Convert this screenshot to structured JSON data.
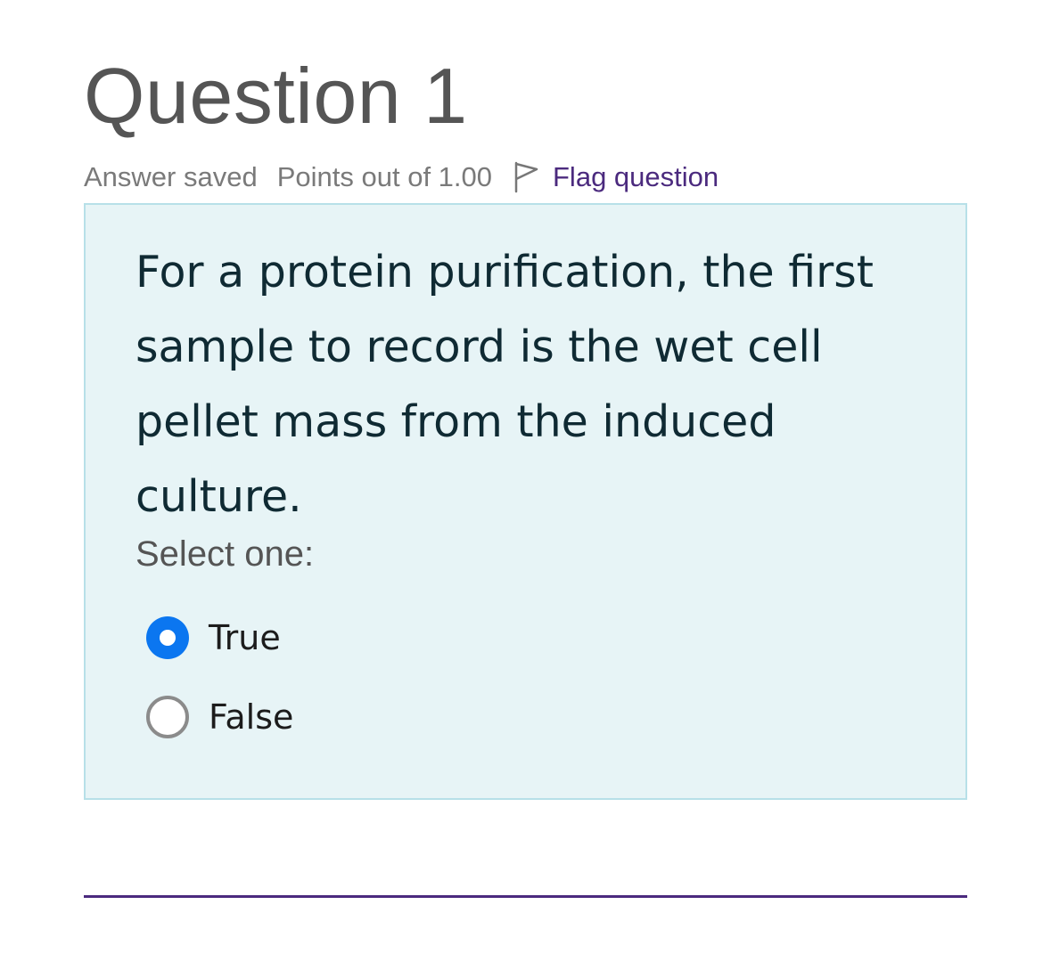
{
  "question": {
    "title": "Question 1",
    "status": "Answer saved",
    "points": "Points out of 1.00",
    "flag_label": "Flag question",
    "flag_icon": "flag-outline-icon",
    "text": "For a protein purification, the first sample to record is the wet cell pellet mass from the induced culture.",
    "prompt": "Select one:",
    "options": [
      {
        "label": "True",
        "selected": true
      },
      {
        "label": "False",
        "selected": false
      }
    ]
  },
  "colors": {
    "question_background": "#e7f4f6",
    "question_border": "#b7e0e8",
    "radio_selected": "#0b76f0",
    "link": "#4b2a7e"
  }
}
